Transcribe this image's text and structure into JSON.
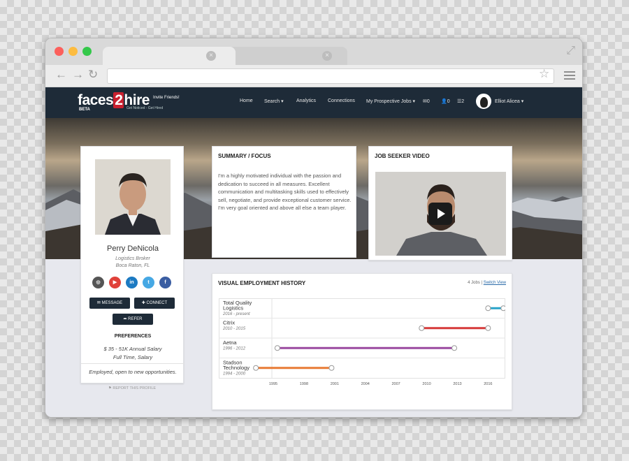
{
  "browser": {
    "tab_close": "×",
    "back": "←",
    "forward": "→",
    "reload": "↻",
    "star": "☆"
  },
  "site": {
    "logo": {
      "text_pre": "faces",
      "text_two": "2",
      "text_post": "hire",
      "beta": "BETA",
      "invite": "Invite Friends!",
      "tagline": "Get Noticed - Get Hired"
    },
    "nav": {
      "home": "Home",
      "search": "Search ▾",
      "analytics": "Analytics",
      "connections": "Connections",
      "prospective": "My Prospective Jobs ▾",
      "messages_count": "0",
      "people_count": "0",
      "notes_count": "2",
      "user_name": "Elliot Alicea ▾"
    },
    "profile": {
      "name": "Perry DeNicola",
      "title": "Logistics Broker",
      "location": "Boca Raton, FL",
      "social": [
        {
          "name": "instagram",
          "glyph": "◎",
          "color": "#555555"
        },
        {
          "name": "youtube",
          "glyph": "▶",
          "color": "#e0413a"
        },
        {
          "name": "linkedin",
          "glyph": "in",
          "color": "#1c7ac2"
        },
        {
          "name": "twitter",
          "glyph": "t",
          "color": "#46a8e4"
        },
        {
          "name": "facebook",
          "glyph": "f",
          "color": "#3a5da2"
        }
      ],
      "message_btn": "✉ MESSAGE",
      "connect_btn": "✚ CONNECT",
      "refer_btn": "➦ REFER",
      "preferences_heading": "PREFERENCES",
      "salary": "$ 35 - 51K Annual Salary",
      "type": "Full Time, Salary",
      "status": "Employed, open to new opportunities.",
      "report": "⚑ REPORT THIS PROFILE"
    },
    "summary": {
      "heading": "SUMMARY / FOCUS",
      "text": "I'm a highly motivated individual with the passion and dedication to succeed in all measures. Excellent communication and multitasking skills used to effectively sell, negotiate, and provide exceptional customer service. I'm very goal oriented and above all else a team player."
    },
    "video": {
      "heading": "JOB SEEKER VIDEO"
    },
    "history": {
      "heading": "VISUAL EMPLOYMENT HISTORY",
      "jobs_count": "4 Jobs |",
      "switch_view": "Switch View"
    }
  },
  "chart_data": {
    "type": "timeline",
    "x_ticks": [
      "1995",
      "1998",
      "2001",
      "2004",
      "2007",
      "2010",
      "2013",
      "2016"
    ],
    "xlim": [
      1995,
      2017
    ],
    "jobs": [
      {
        "company": "Total Quality Logistics",
        "period": "2016 - present",
        "start": 2016.0,
        "end": 2017.5,
        "color": "#29a3c9"
      },
      {
        "company": "Citrix",
        "period": "2010 - 2015",
        "start": 2009.5,
        "end": 2016.0,
        "color": "#d63a3a"
      },
      {
        "company": "Aetna",
        "period": "1996 - 2012",
        "start": 1995.4,
        "end": 2012.7,
        "color": "#9a4aa0"
      },
      {
        "company": "Stadson Technology",
        "period": "1994 - 2000",
        "start": 1993.3,
        "end": 2000.7,
        "color": "#e87b35"
      }
    ]
  }
}
